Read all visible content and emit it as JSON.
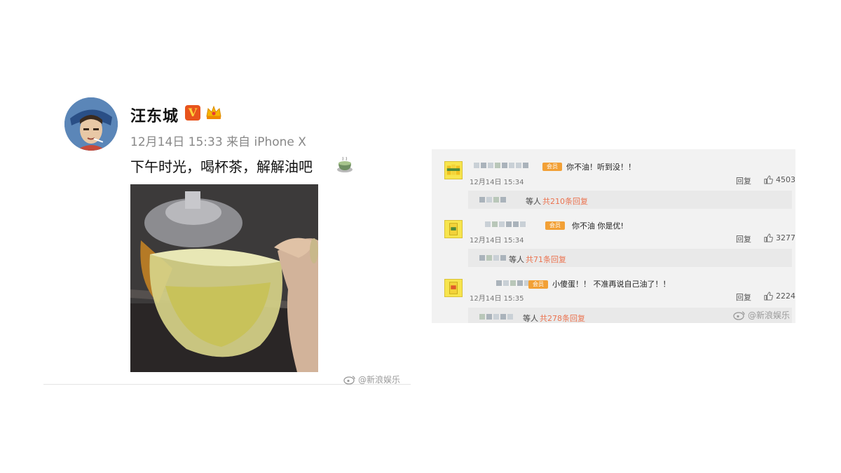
{
  "post": {
    "username": "汪东城",
    "verified_badge": "V",
    "badge_icon": "crown-icon",
    "meta": "12月14日 15:33 来自 iPhone X",
    "text": "下午时光，喝杯茶，解解油吧",
    "emoji": "tea-icon",
    "photo": "tea-cup-photo"
  },
  "comments": [
    {
      "vip": "会员",
      "text": "你不油！听到没！！",
      "time": "12月14日 15:34",
      "reply_label": "回复",
      "likes": "4503",
      "sub_people": "等人",
      "sub_count": "共210条回复"
    },
    {
      "vip": "会员",
      "text": "你不油  你是优!",
      "time": "12月14日 15:34",
      "reply_label": "回复",
      "likes": "3277",
      "sub_people": "等人",
      "sub_count": "共71条回复"
    },
    {
      "vip": "会员",
      "text": "小傻蛋！！ 不准再说自己油了！！",
      "time": "12月14日 15:35",
      "reply_label": "回复",
      "likes": "2224",
      "sub_people": "等人",
      "sub_count": "共278条回复"
    }
  ],
  "watermark": "@新浪娱乐",
  "colors": {
    "accent_orange": "#eb7350",
    "vip_orange": "#f2a036",
    "verified_orange": "#e8541c",
    "panel_bg": "#f2f2f2"
  }
}
